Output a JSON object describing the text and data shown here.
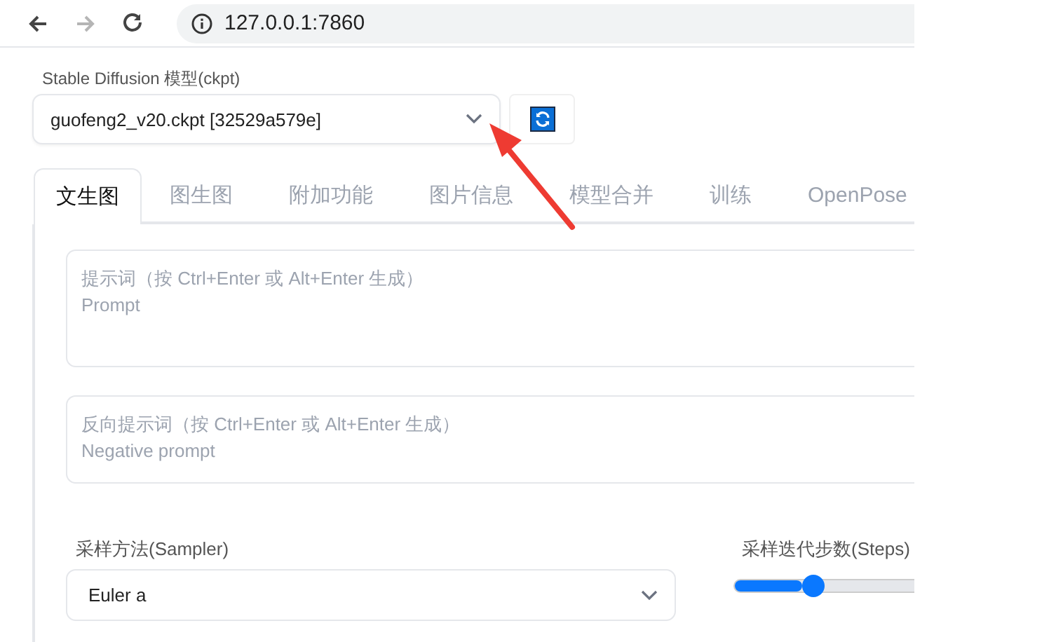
{
  "browser": {
    "url": "127.0.0.1:7860",
    "nav": [
      {
        "kind": "back",
        "disabled": false
      },
      {
        "kind": "forward",
        "disabled": true
      },
      {
        "kind": "reload",
        "disabled": false
      }
    ]
  },
  "model": {
    "label": "Stable Diffusion 模型(ckpt)",
    "value": "guofeng2_v20.ckpt [32529a579e]"
  },
  "tabs": [
    {
      "label": "文生图",
      "selected": true
    },
    {
      "label": "图生图",
      "selected": false
    },
    {
      "label": "附加功能",
      "selected": false
    },
    {
      "label": "图片信息",
      "selected": false
    },
    {
      "label": "模型合并",
      "selected": false
    },
    {
      "label": "训练",
      "selected": false
    },
    {
      "label": "OpenPose",
      "selected": false
    }
  ],
  "prompt": {
    "label": "提示词（按 Ctrl+Enter 或 Alt+Enter 生成）",
    "placeholder": "Prompt"
  },
  "negative_prompt": {
    "label": "反向提示词（按 Ctrl+Enter 或 Alt+Enter 生成）",
    "placeholder": "Negative prompt"
  },
  "sampler": {
    "label": "采样方法(Sampler)",
    "value": "Euler a"
  },
  "steps": {
    "label": "采样迭代步数(Steps)",
    "level": 0.44
  }
}
